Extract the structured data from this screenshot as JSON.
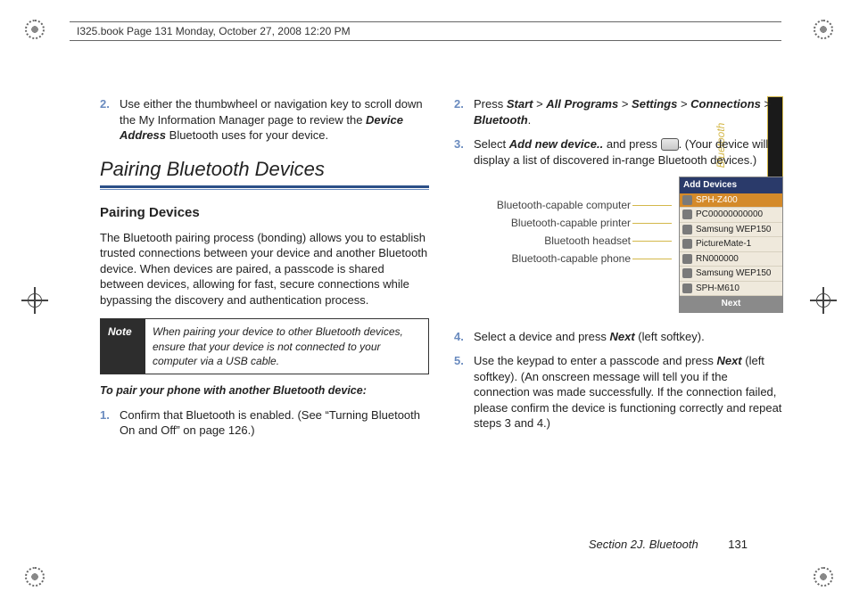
{
  "header": "I325.book  Page 131  Monday, October 27, 2008  12:20 PM",
  "left": {
    "step2": {
      "num": "2.",
      "text_a": "Use either the thumbwheel or navigation key to scroll down the My Information Manager page to review the ",
      "device_address": "Device Address",
      "text_b": " Bluetooth uses for your device."
    },
    "section_title": "Pairing Bluetooth Devices",
    "subhead": "Pairing Devices",
    "para": "The Bluetooth pairing process (bonding) allows you to establish trusted connections between your device and another Bluetooth device. When devices are paired, a passcode is shared between devices, allowing for fast, secure connections while bypassing the discovery and authentication process.",
    "note_label": "Note",
    "note_text": "When pairing your device to other Bluetooth devices, ensure that your device is not connected to your computer via a USB cable.",
    "instr_lead": "To pair your phone with another Bluetooth device:",
    "step1": {
      "num": "1.",
      "text": "Confirm that Bluetooth is enabled. (See “Turning Bluetooth On and Off” on page 126.)"
    }
  },
  "right": {
    "step2": {
      "num": "2.",
      "press": "Press ",
      "start": "Start",
      "gt": " > ",
      "allprograms": "All Programs",
      "settings": "Settings",
      "connections": "Connections",
      "bluetooth": "Bluetooth",
      "period": "."
    },
    "step3": {
      "num": "3.",
      "a": "Select ",
      "add": "Add new device..",
      "b": " and press ",
      "c": ". (Your device will display a list of discovered in-range Bluetooth devices.)"
    },
    "callouts": {
      "c1": "Bluetooth-capable computer",
      "c2": "Bluetooth-capable printer",
      "c3": "Bluetooth headset",
      "c4": "Bluetooth-capable phone"
    },
    "shot": {
      "title": "Add Devices",
      "rows": [
        "SPH-Z400",
        "PC00000000000",
        "Samsung WEP150",
        "PictureMate-1",
        "RN000000",
        "Samsung WEP150",
        "SPH-M610"
      ],
      "bottom": "Next"
    },
    "step4": {
      "num": "4.",
      "a": "Select a device and press ",
      "next": "Next",
      "b": " (left softkey)."
    },
    "step5": {
      "num": "5.",
      "a": "Use the keypad to enter a passcode and press ",
      "next": "Next",
      "b": " (left softkey). (An onscreen message will tell you if the connection was made successfully. If the connection failed, please confirm the device is functioning correctly and repeat steps 3 and 4.)"
    }
  },
  "side_tab": "Bluetooth",
  "footer_section": "Section 2J. Bluetooth",
  "footer_page": "131"
}
